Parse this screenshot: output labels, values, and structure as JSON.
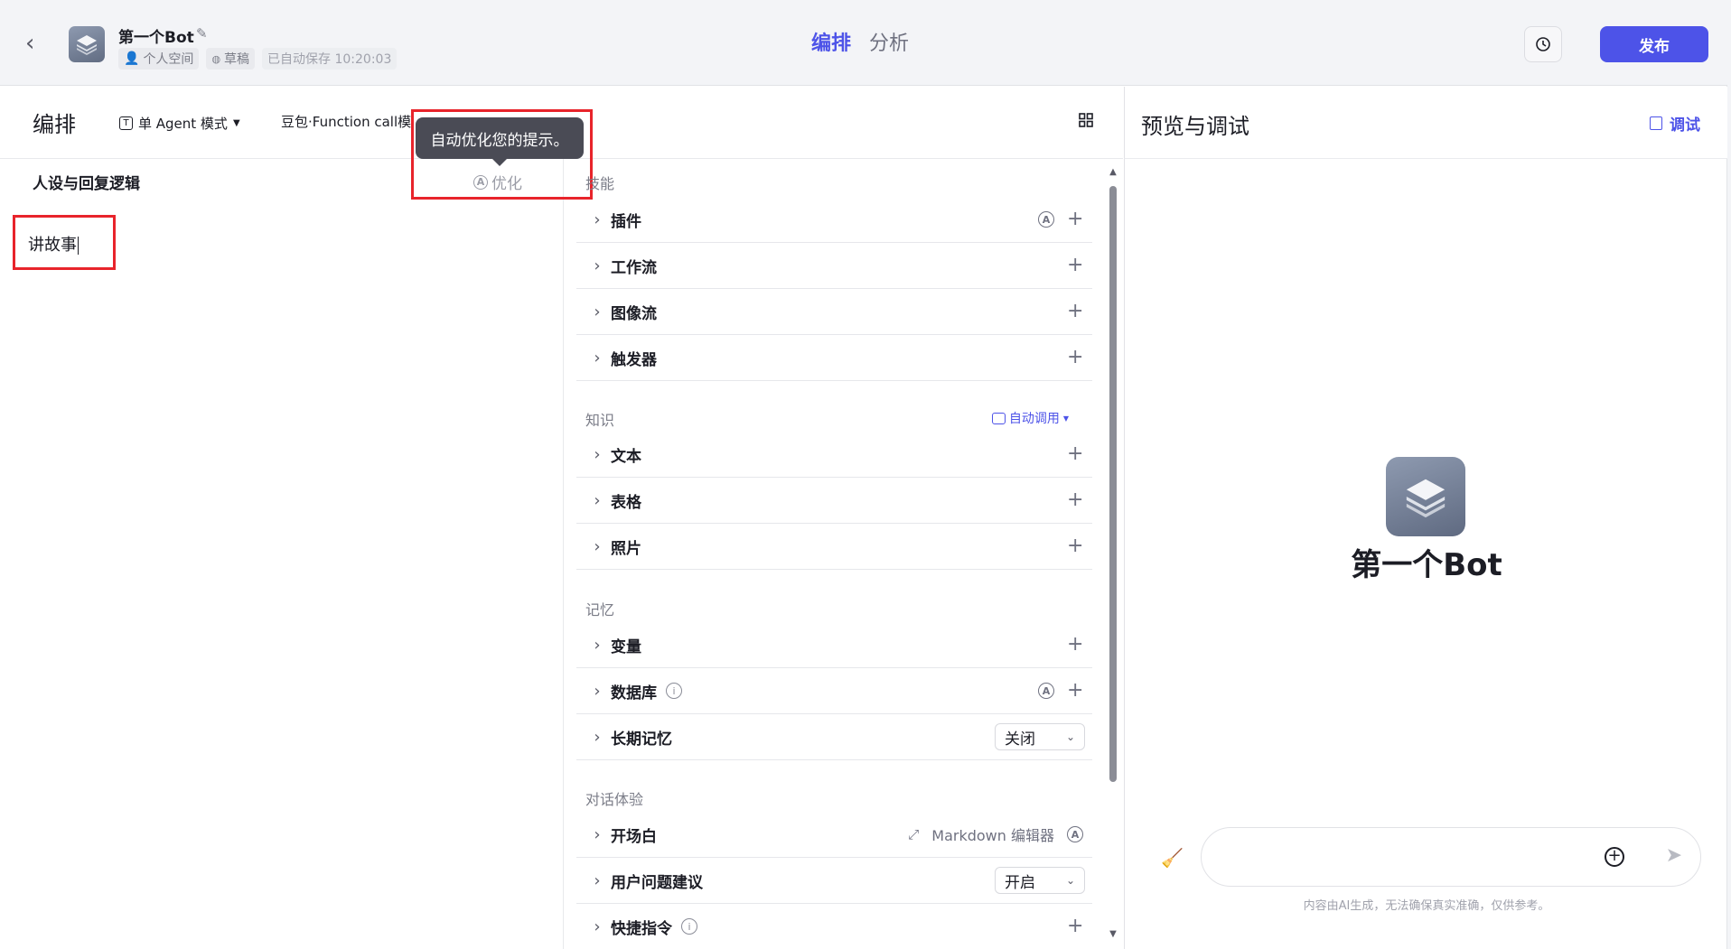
{
  "header": {
    "bot_name": "第一个Bot",
    "space": "个人空间",
    "status": "草稿",
    "autosave": "已自动保存 10:20:03",
    "tabs": [
      "编排",
      "分析"
    ],
    "publish_label": "发布"
  },
  "toolbar": {
    "section_title": "编排",
    "mode": "单 Agent 模式",
    "model": "豆包·Function call模型"
  },
  "prompt": {
    "title": "人设与回复逻辑",
    "optimize_label": "优化",
    "tooltip": "自动优化您的提示。",
    "content": "讲故事"
  },
  "skills": {
    "title": "技能",
    "items": [
      "插件",
      "工作流",
      "图像流",
      "触发器"
    ]
  },
  "knowledge": {
    "title": "知识",
    "auto_call": "自动调用",
    "items": [
      "文本",
      "表格",
      "照片"
    ]
  },
  "memory": {
    "title": "记忆",
    "items": [
      "变量",
      "数据库",
      "长期记忆"
    ],
    "long_memory_value": "关闭"
  },
  "dialog": {
    "title": "对话体验",
    "items": [
      "开场白",
      "用户问题建议",
      "快捷指令"
    ],
    "markdown_label": "Markdown 编辑器",
    "suggest_value": "开启"
  },
  "preview": {
    "title": "预览与调试",
    "debug_label": "调试",
    "bot_name": "第一个Bot",
    "disclaimer": "内容由AI生成，无法确保真实准确，仅供参考。"
  },
  "colors": {
    "accent": "#4d53e8",
    "highlight_border": "#e8242b"
  }
}
